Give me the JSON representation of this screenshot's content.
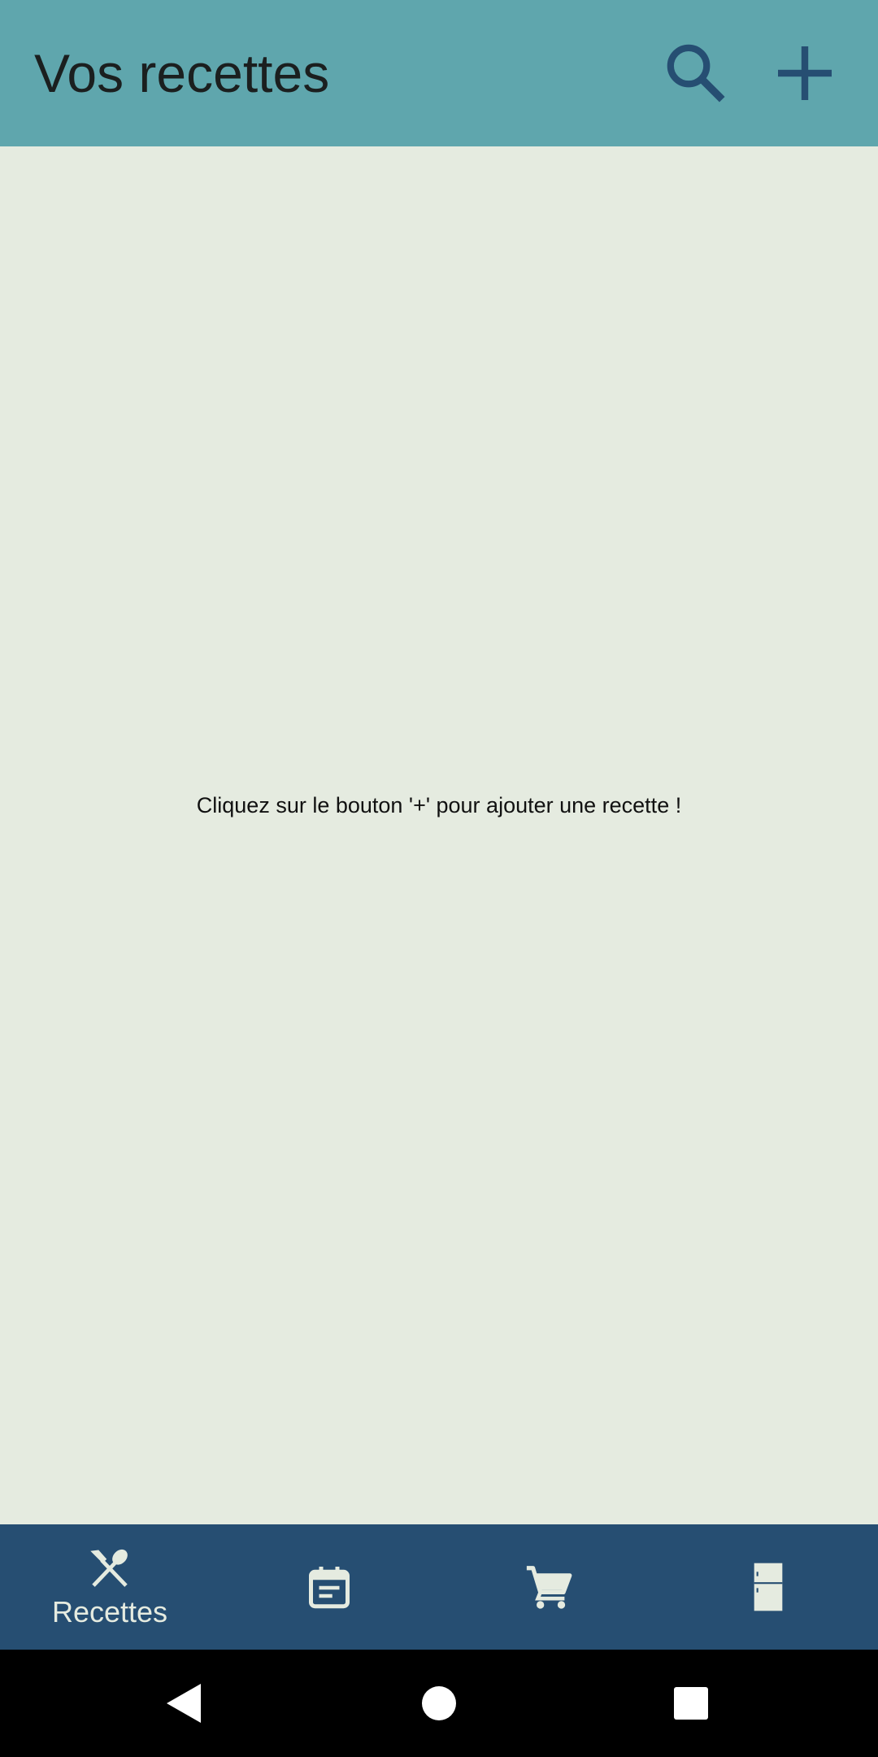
{
  "appbar": {
    "title": "Vos recettes",
    "actions": [
      {
        "icon": "search-icon"
      },
      {
        "icon": "plus-icon"
      }
    ]
  },
  "content": {
    "empty_message": "Cliquez sur le bouton '+' pour ajouter une recette !"
  },
  "bottom_nav": {
    "items": [
      {
        "icon": "fork-spoon-icon",
        "label": "Recettes",
        "selected": true
      },
      {
        "icon": "calendar-icon",
        "label": "",
        "selected": false
      },
      {
        "icon": "cart-icon",
        "label": "",
        "selected": false
      },
      {
        "icon": "fridge-icon",
        "label": "",
        "selected": false
      }
    ]
  },
  "system_nav": {
    "buttons": [
      "back-icon",
      "home-icon",
      "recents-icon"
    ]
  },
  "colors": {
    "appbar": "#5fa6ad",
    "background": "#e5ebe0",
    "bottom_nav": "#264e72",
    "icon_dark_blue": "#264e72",
    "nav_icon": "#e5ebe0"
  }
}
